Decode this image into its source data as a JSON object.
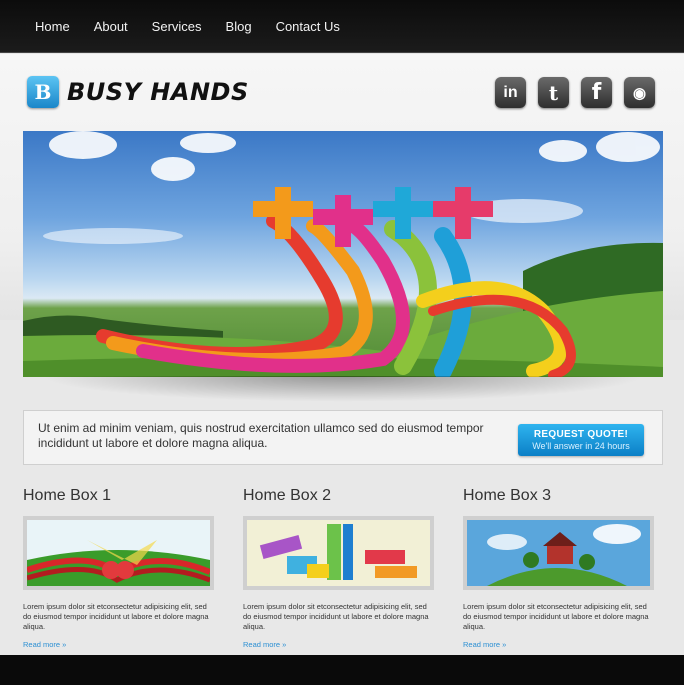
{
  "nav": {
    "items": [
      "Home",
      "About",
      "Services",
      "Blog",
      "Contact Us"
    ]
  },
  "logo": {
    "letter": "B",
    "text": "BUSY HANDS"
  },
  "social": [
    {
      "icon": "linkedin-icon",
      "glyph": "in"
    },
    {
      "icon": "twitter-icon",
      "glyph": "t"
    },
    {
      "icon": "facebook-icon",
      "glyph": "f"
    },
    {
      "icon": "rss-icon",
      "glyph": "◉"
    }
  ],
  "quote": {
    "text": "Ut enim ad minim veniam, quis nostrud exercitation ullamco sed do eiusmod tempor incididunt ut labore et dolore magna aliqua.",
    "button_label": "REQUEST QUOTE!",
    "button_sub": "We'll answer in 24 hours"
  },
  "boxes": [
    {
      "title": "Home Box 1",
      "text": "Lorem ipsum dolor sit etconsectetur adipisicing elit, sed do eiusmod tempor incididunt ut labore et dolore magna aliqua.",
      "link": "Read more »"
    },
    {
      "title": "Home Box 2",
      "text": "Lorem ipsum dolor sit etconsectetur adipisicing elit, sed do eiusmod tempor incididunt ut labore et dolore magna aliqua.",
      "link": "Read more »"
    },
    {
      "title": "Home Box 3",
      "text": "Lorem ipsum dolor sit etconsectetur adipisicing elit, sed do eiusmod tempor incididunt ut labore et dolore magna aliqua.",
      "link": "Read more »"
    }
  ],
  "colors": {
    "accent": "#1a8fd8",
    "nav_bg": "#111111",
    "link": "#2b8fd3"
  }
}
